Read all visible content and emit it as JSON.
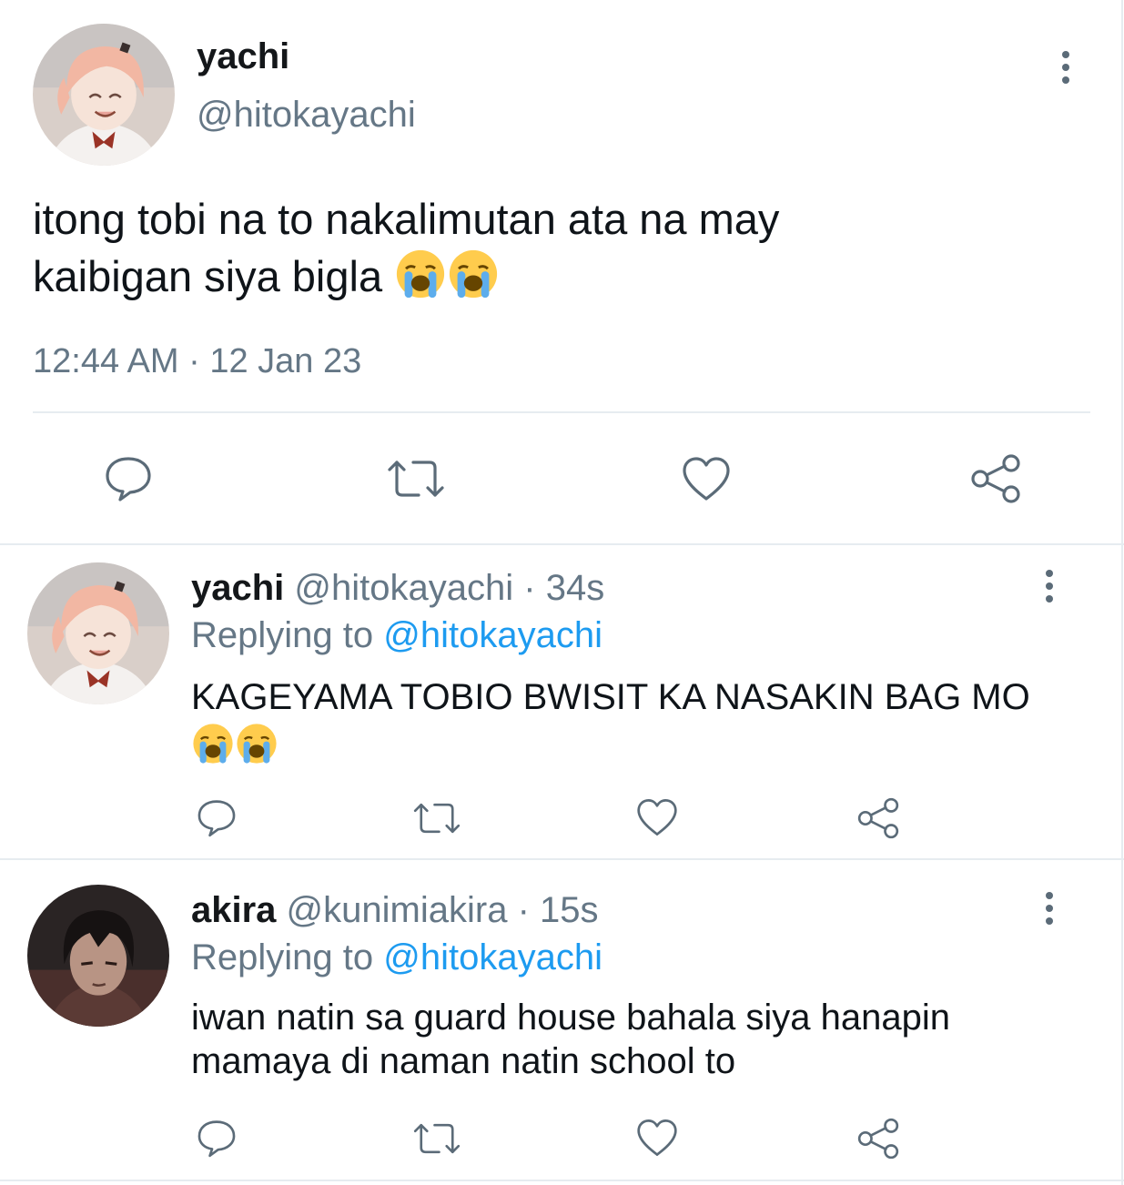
{
  "main_tweet": {
    "display_name": "yachi",
    "handle": "@hitokayachi",
    "text": "itong tobi na to nakalimutan ata na may kaibigan siya bigla",
    "emoji": [
      "loudly-crying-face",
      "loudly-crying-face"
    ],
    "timestamp": "12:44 AM · 12 Jan 23"
  },
  "replies": [
    {
      "display_name": "yachi",
      "handle": "@hitokayachi",
      "time": "· 34s",
      "replying_label": "Replying to",
      "replying_to": "@hitokayachi",
      "text": "KAGEYAMA TOBIO BWISIT KA NASAKIN BAG MO",
      "emoji": [
        "loudly-crying-face",
        "loudly-crying-face"
      ]
    },
    {
      "display_name": "akira",
      "handle": "@kunimiakira",
      "time": "· 15s",
      "replying_label": "Replying to",
      "replying_to": "@hitokayachi",
      "text": "iwan natin sa guard house bahala siya hanapin mamaya di naman natin school to"
    }
  ],
  "actions": [
    "reply-icon",
    "retweet-icon",
    "like-icon",
    "share-icon"
  ],
  "colors": {
    "link": "#1d9bf0",
    "muted": "#657786",
    "icon": "#5b6b78",
    "divider": "#e6ecf0"
  }
}
